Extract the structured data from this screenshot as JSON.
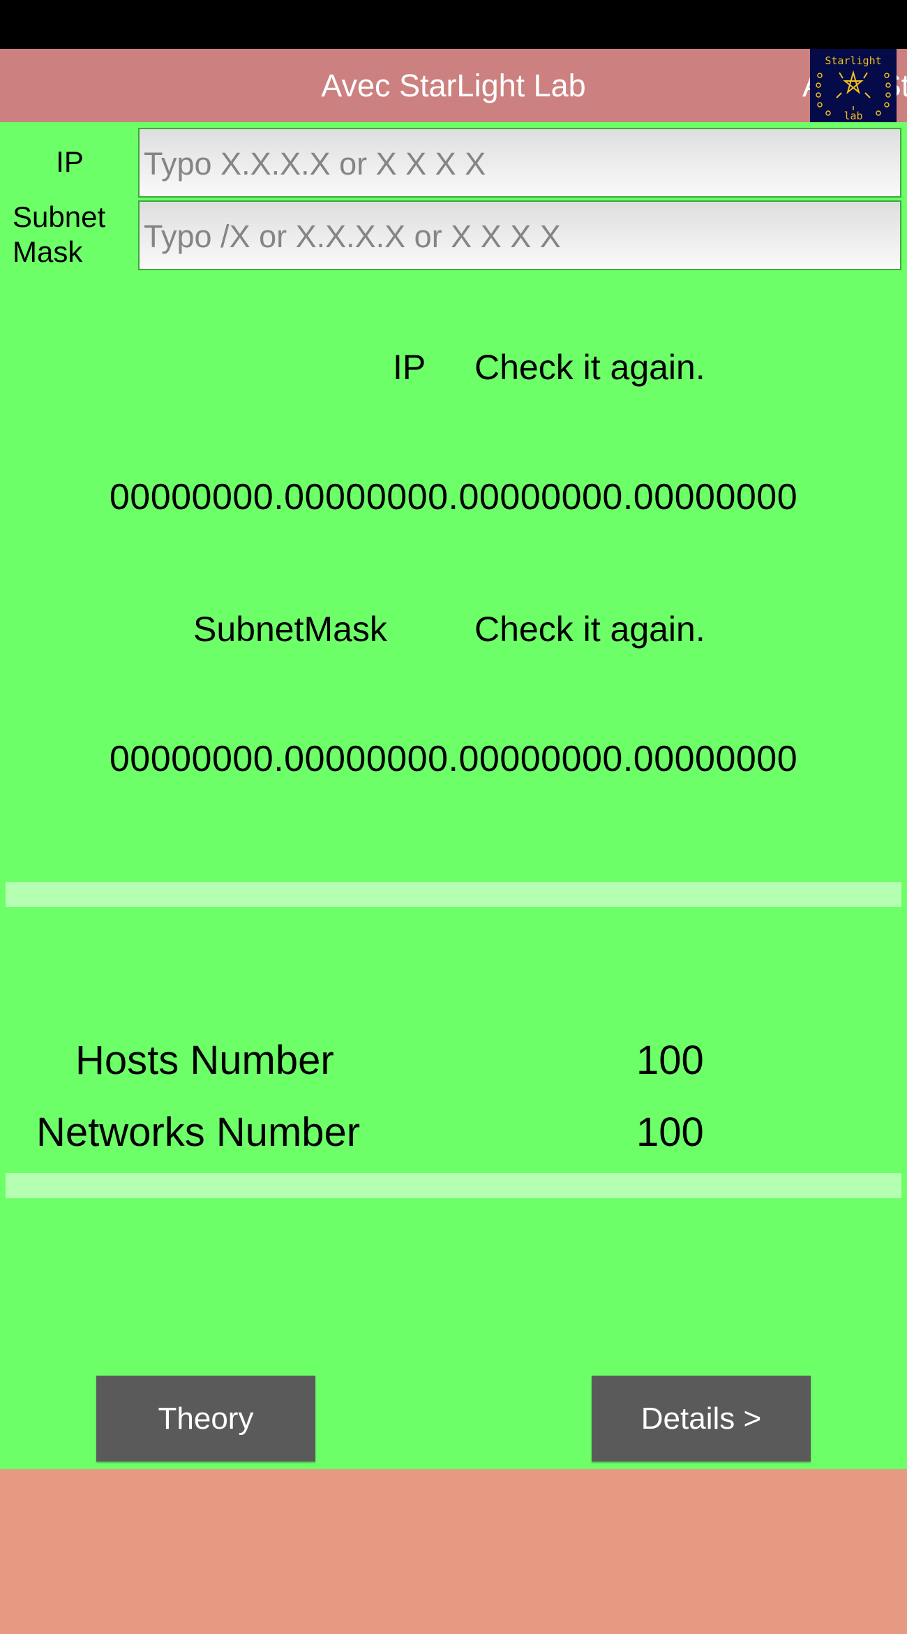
{
  "colors": {
    "status_bar": "#000000",
    "title_bar": "#cc8080",
    "content_bg": "#6cff68",
    "divider": "#b5ffb2",
    "button_bg": "#5a5a5a",
    "button_text": "#ffffff",
    "footer_bg": "#e69a82",
    "logo_bg": "#050a48",
    "logo_fg": "#f2c21a"
  },
  "header": {
    "title": "Avec StarLight Lab",
    "logo_text_top": "Starlight",
    "logo_text_bottom": "lab",
    "logo_icon": "starlight-lab-logo"
  },
  "form": {
    "ip": {
      "label": "IP",
      "value": "",
      "placeholder": "Typo X.X.X.X or X X X X"
    },
    "subnet": {
      "label_line1": "Subnet",
      "label_line2": "Mask",
      "value": "",
      "placeholder": "Typo /X or X.X.X.X or X X X X"
    }
  },
  "results": {
    "ip": {
      "label": "IP",
      "status": "Check it again.",
      "binary": "00000000.00000000.00000000.00000000"
    },
    "subnet": {
      "label": "SubnetMask",
      "status": "Check it again.",
      "binary": "00000000.00000000.00000000.00000000"
    }
  },
  "counts": {
    "hosts": {
      "label": "Hosts Number",
      "value": "100"
    },
    "networks": {
      "label": "Networks Number",
      "value": "100"
    }
  },
  "buttons": {
    "theory": "Theory",
    "details": "Details >"
  }
}
